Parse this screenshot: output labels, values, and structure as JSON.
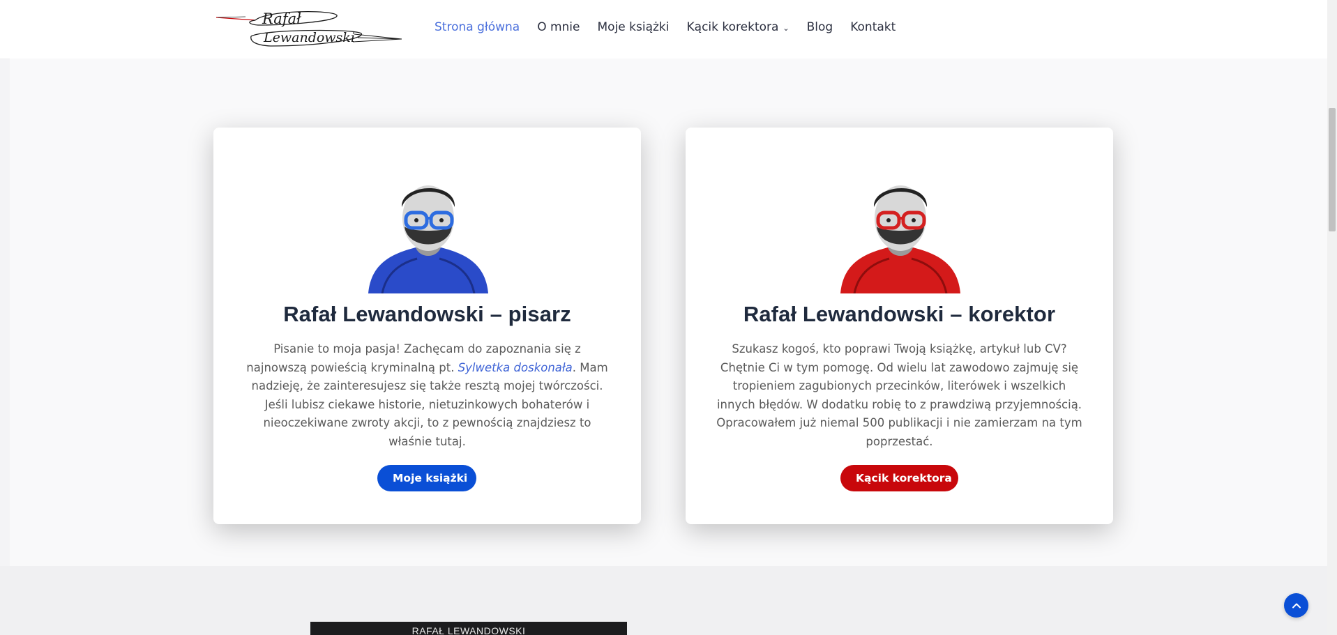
{
  "header": {
    "logo_icon": "signature-pen-logo",
    "logo_line1": "Rafał",
    "logo_line2": "Lewandowski",
    "nav": [
      {
        "label": "Strona główna",
        "active": true
      },
      {
        "label": "O mnie"
      },
      {
        "label": "Moje książki"
      },
      {
        "label": "Kącik korektora",
        "has_dropdown": true
      },
      {
        "label": "Blog"
      },
      {
        "label": "Kontakt"
      }
    ]
  },
  "cards": {
    "writer": {
      "avatar_icon": "portrait-blue-icon",
      "title": "Rafał Lewandowski – pisarz",
      "text_before": "Pisanie to moja pasja! Zachęcam do zapoznania się z najnowszą powieścią kryminalną pt. ",
      "text_link": "Sylwetka doskonała",
      "text_after": ". Mam nadzieję, że zainteresujesz się także resztą mojej twórczości. Jeśli lubisz ciekawe historie, nietuzinkowych bohaterów i nieoczekiwane zwroty akcji, to z pewnością znajdziesz to właśnie tutaj.",
      "button": "Moje książki",
      "accent": "#0a4fd6"
    },
    "proofreader": {
      "avatar_icon": "portrait-red-icon",
      "title": "Rafał Lewandowski – korektor",
      "text": "Szukasz kogoś, kto poprawi Twoją książkę, artykuł lub CV? Chętnie Ci w tym pomogę. Od wielu lat zawodowo zajmuję się tropieniem zagubionych przecinków, literówek i wszelkich innych błędów. W dodatku robię to z prawdziwą przyjemnością. Opracowałem już niemal 500 publikacji i nie zamierzam na tym poprzestać.",
      "button": "Kącik korektora",
      "accent": "#c8070b"
    }
  },
  "footer_box": {
    "label": "RAFAŁ LEWANDOWSKI"
  },
  "controls": {
    "back_to_top_icon": "chevron-up-icon"
  }
}
